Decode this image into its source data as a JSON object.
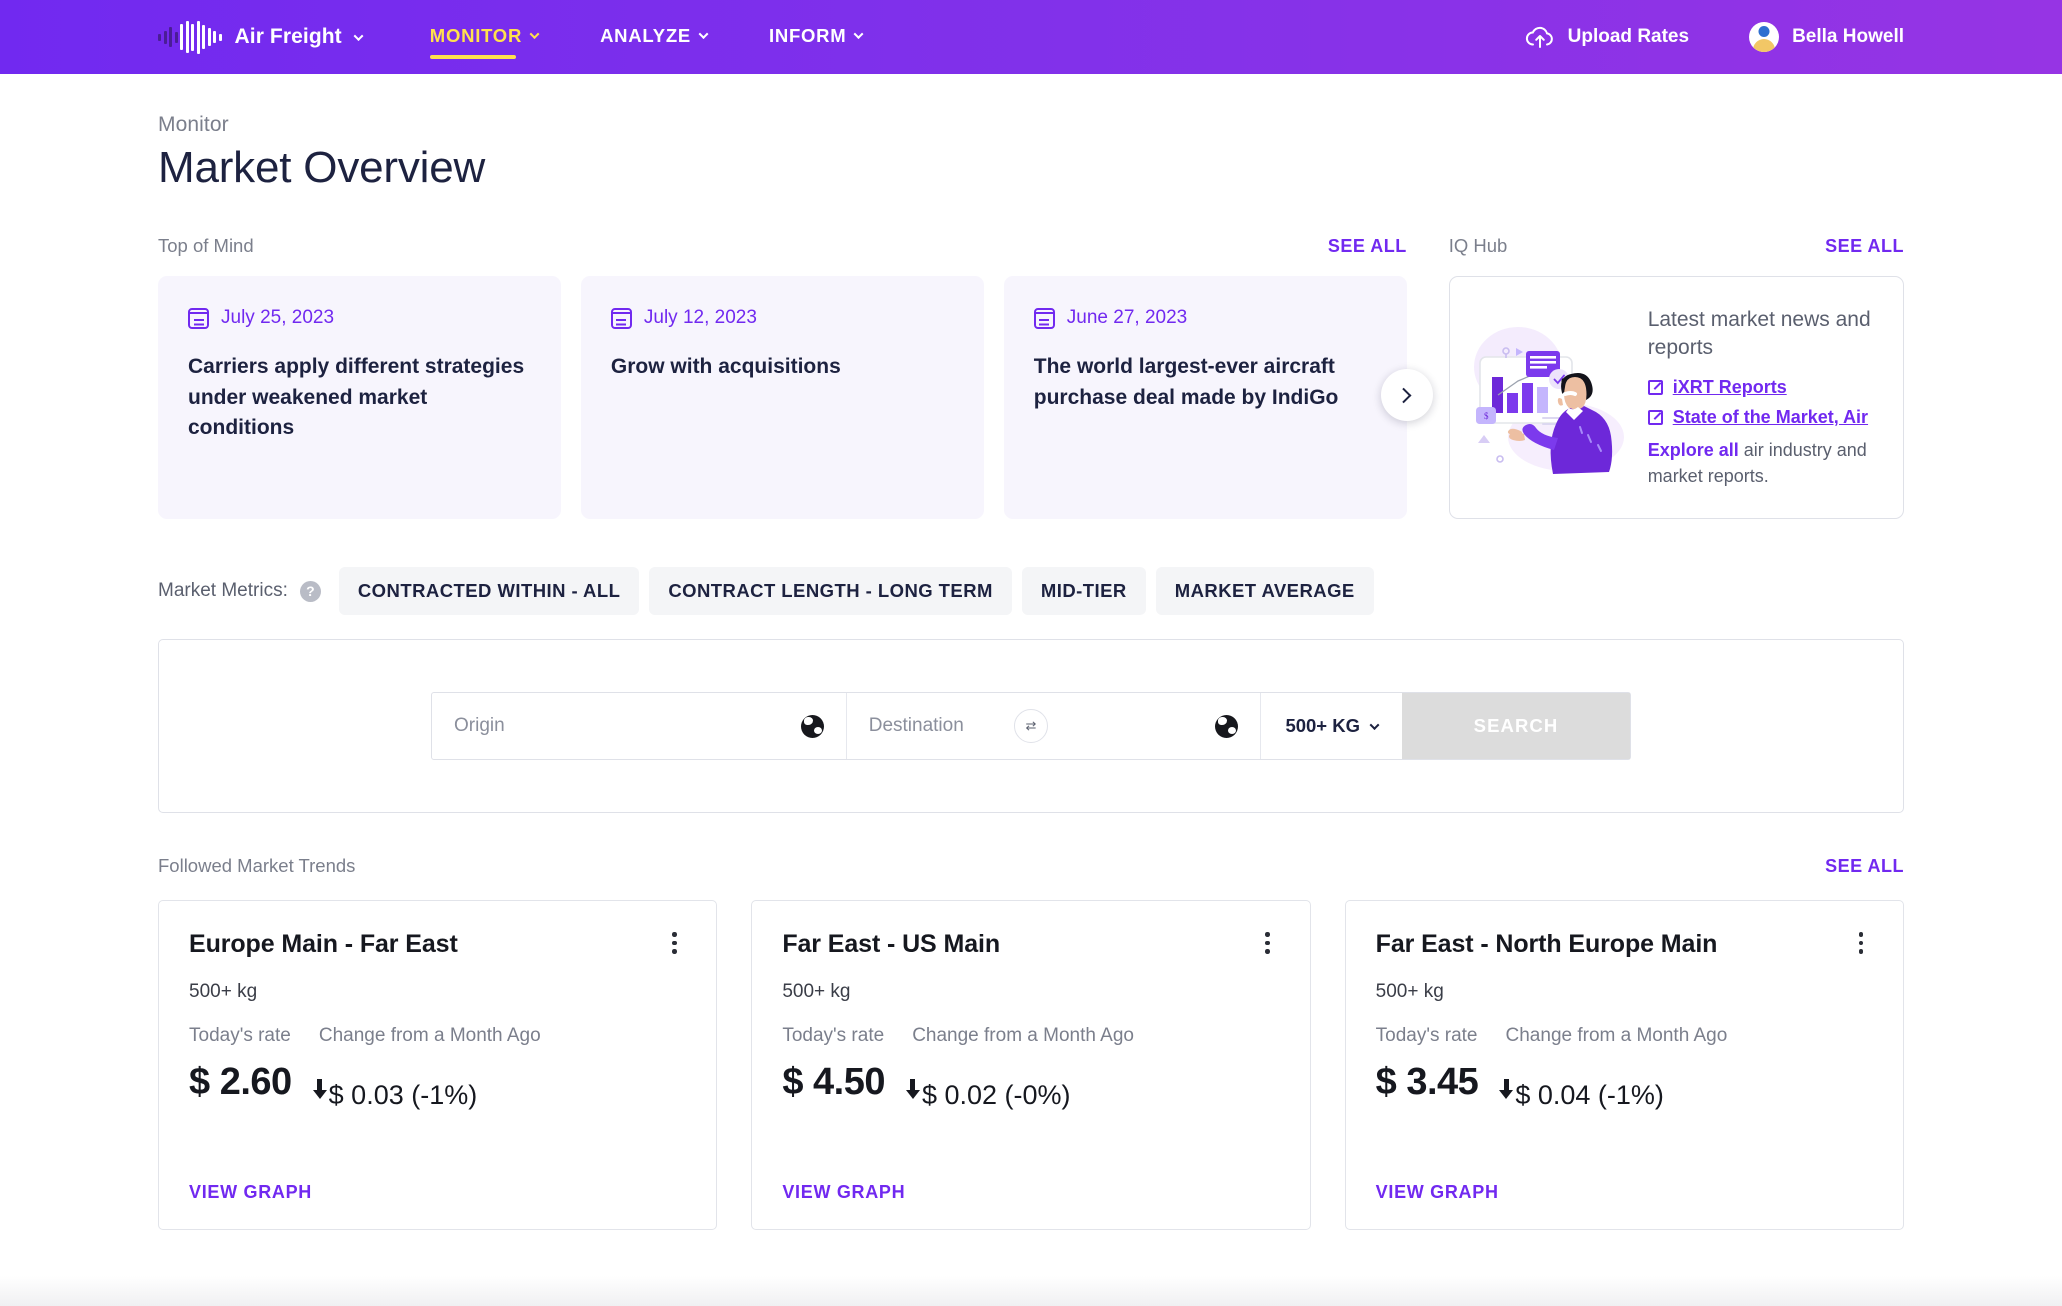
{
  "nav": {
    "brand": "Air Freight",
    "brand_icon": "soundwave-logo-icon",
    "items": [
      {
        "label": "MONITOR",
        "active": true
      },
      {
        "label": "ANALYZE",
        "active": false
      },
      {
        "label": "INFORM",
        "active": false
      }
    ],
    "upload_label": "Upload Rates",
    "upload_icon": "cloud-upload-icon",
    "user_name": "Bella Howell",
    "accent_active": "#ffe14d",
    "gradient_start": "#7129f0",
    "gradient_end": "#9634e4"
  },
  "header": {
    "eyebrow": "Monitor",
    "title": "Market Overview"
  },
  "top_of_mind": {
    "label": "Top of Mind",
    "see_all": "SEE ALL",
    "next_icon": "chevron-right-icon",
    "cards": [
      {
        "date": "July 25, 2023",
        "title": "Carriers apply different strategies under weakened market conditions"
      },
      {
        "date": "July 12, 2023",
        "title": "Grow with acquisitions"
      },
      {
        "date": "June 27, 2023",
        "title": "The world largest-ever aircraft purchase deal made by IndiGo"
      }
    ]
  },
  "iq_hub": {
    "label": "IQ Hub",
    "see_all": "SEE ALL",
    "heading": "Latest market news and reports",
    "links": [
      {
        "label": "iXRT Reports"
      },
      {
        "label": "State of the Market, Air"
      }
    ],
    "explore_link": "Explore all",
    "explore_rest": " air industry and market reports."
  },
  "market_metrics": {
    "label": "Market Metrics:",
    "help_glyph": "?",
    "pills": [
      "CONTRACTED WITHIN - ALL",
      "CONTRACT LENGTH - LONG TERM",
      "MID-TIER",
      "MARKET AVERAGE"
    ]
  },
  "search": {
    "origin_placeholder": "Origin",
    "origin_value": "",
    "destination_placeholder": "Destination",
    "destination_value": "",
    "swap_glyph": "⇄",
    "weight_value": "500+ KG",
    "button_label": "SEARCH",
    "button_disabled": true
  },
  "followed_trends": {
    "label": "Followed Market Trends",
    "see_all": "SEE ALL",
    "col_rate": "Today's rate",
    "col_change": "Change from a Month Ago",
    "view_graph": "VIEW GRAPH",
    "cards": [
      {
        "name": "Europe Main - Far East",
        "weight": "500+ kg",
        "rate": "$ 2.60",
        "change": "$ 0.03 (-1%)",
        "direction": "down"
      },
      {
        "name": "Far East - US Main",
        "weight": "500+ kg",
        "rate": "$ 4.50",
        "change": "$ 0.02 (-0%)",
        "direction": "down"
      },
      {
        "name": "Far East - North Europe Main",
        "weight": "500+ kg",
        "rate": "$ 3.45",
        "change": "$ 0.04 (-1%)",
        "direction": "down"
      }
    ]
  }
}
